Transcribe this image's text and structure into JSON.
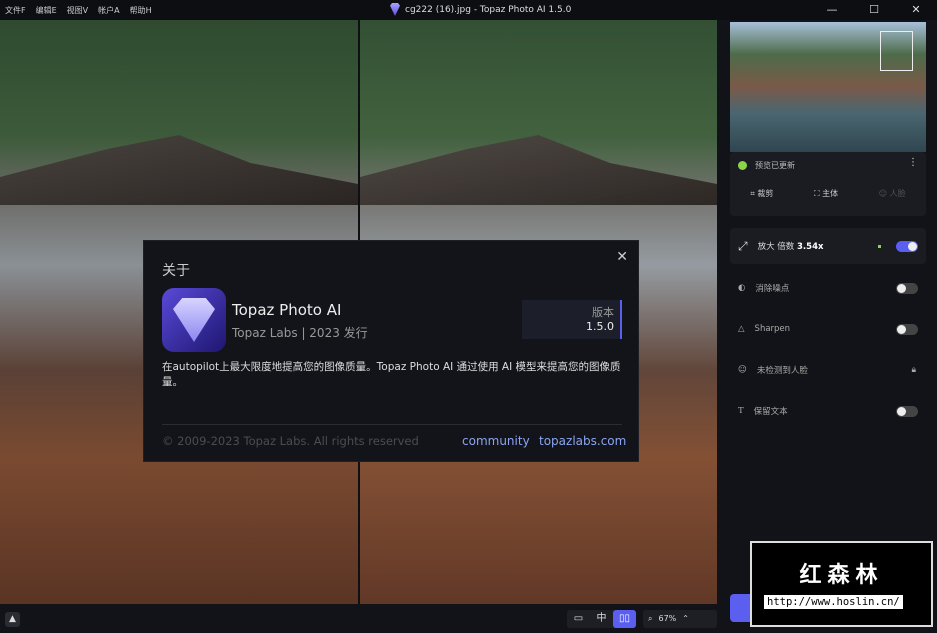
{
  "menu": [
    "文件F",
    "编辑E",
    "视图V",
    "帐户A",
    "帮助H"
  ],
  "window_title": "cg222 (16).jpg - Topaz Photo AI 1.5.0",
  "window_buttons": [
    "—",
    "☐",
    "✕"
  ],
  "about": {
    "heading": "关于",
    "app_name": "Topaz Photo AI",
    "vendor": "Topaz Labs",
    "release": "2023 发行",
    "version_label": "版本",
    "version": "1.5.0",
    "description": "在autopilot上最大限度地提高您的图像质量。Topaz Photo AI 通过使用 AI 模型来提高您的图像质量。",
    "copyright": "© 2009-2023 Topaz Labs. All rights reserved",
    "link_community": "community",
    "link_site": "topazlabs.com",
    "close": "✕"
  },
  "sidebar": {
    "preview_status": "预览已更新",
    "tools": [
      "裁剪",
      "主体",
      "人脸"
    ],
    "upscale_label": "放大 倍数",
    "upscale_value": "3.54x",
    "denoise": "消除噪点",
    "sharpen": "Sharpen",
    "face": "未检测到人脸",
    "text": "保留文本"
  },
  "bottom": {
    "zoom": "67%",
    "view_single": "▭",
    "view_split": "中",
    "view_side": "▯▯"
  },
  "watermark": {
    "title": "红森林",
    "url": "http://www.hoslin.cn/"
  }
}
